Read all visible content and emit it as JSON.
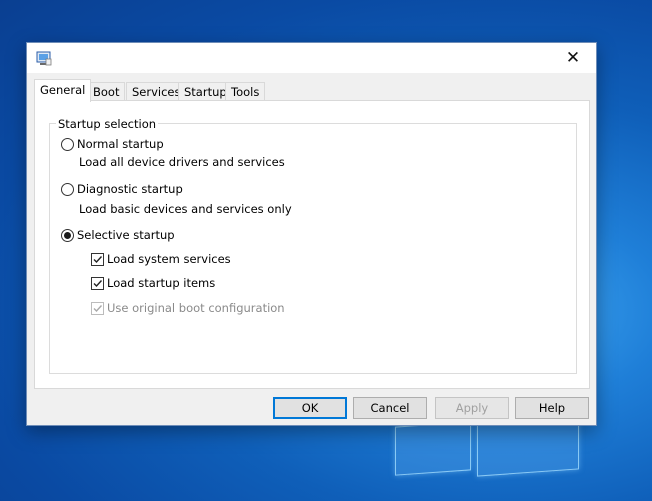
{
  "window": {
    "title": "",
    "close_glyph": "✕",
    "app_icon": "msconfig-icon"
  },
  "tabs": [
    {
      "label": "General",
      "active": true
    },
    {
      "label": "Boot",
      "active": false
    },
    {
      "label": "Services",
      "active": false
    },
    {
      "label": "Startup",
      "active": false
    },
    {
      "label": "Tools",
      "active": false
    }
  ],
  "startup_selection": {
    "group_label": "Startup selection",
    "options": [
      {
        "label": "Normal startup",
        "description": "Load all device drivers and services",
        "selected": false
      },
      {
        "label": "Diagnostic startup",
        "description": "Load basic devices and services only",
        "selected": false
      },
      {
        "label": "Selective startup",
        "description": "",
        "selected": true
      }
    ],
    "selective_options": [
      {
        "label": "Load system services",
        "checked": true,
        "enabled": true
      },
      {
        "label": "Load startup items",
        "checked": true,
        "enabled": true
      },
      {
        "label": "Use original boot configuration",
        "checked": true,
        "enabled": false
      }
    ]
  },
  "buttons": {
    "ok": "OK",
    "cancel": "Cancel",
    "apply": "Apply",
    "help": "Help"
  },
  "colors": {
    "accent": "#0078d7",
    "desktop": "#0f5fb9",
    "dialog_bg": "#f0f0f0"
  }
}
